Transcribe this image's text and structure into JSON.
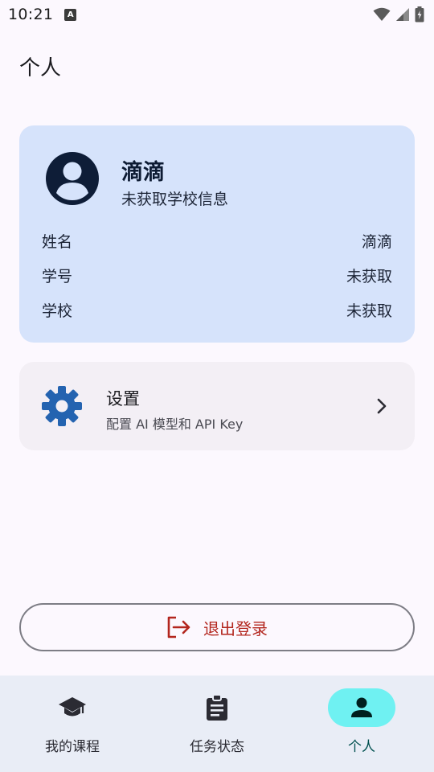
{
  "status_bar": {
    "time": "10:21",
    "notification_icon": "A"
  },
  "page": {
    "title": "个人"
  },
  "profile": {
    "name": "滴滴",
    "school_status": "未获取学校信息",
    "rows": [
      {
        "label": "姓名",
        "value": "滴滴"
      },
      {
        "label": "学号",
        "value": "未获取"
      },
      {
        "label": "学校",
        "value": "未获取"
      }
    ]
  },
  "settings": {
    "title": "设置",
    "subtitle": "配置 AI 模型和 API Key"
  },
  "logout": {
    "label": "退出登录"
  },
  "nav": {
    "items": [
      {
        "label": "我的课程",
        "icon": "graduation-cap-icon"
      },
      {
        "label": "任务状态",
        "icon": "clipboard-icon"
      },
      {
        "label": "个人",
        "icon": "person-icon"
      }
    ],
    "active_index": 2
  },
  "colors": {
    "profile_card": "#d6e3fb",
    "settings_card": "#f3eff5",
    "gear": "#2463b0",
    "logout_text": "#b3261e",
    "nav_active": "#6ff1f2"
  }
}
